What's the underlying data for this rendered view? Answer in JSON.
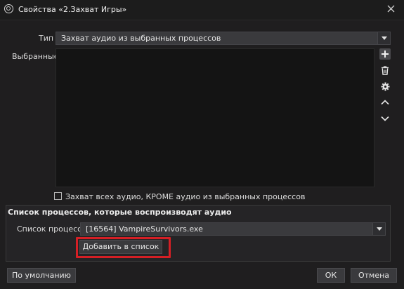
{
  "window": {
    "title": "Свойства «2.Захват Игры»"
  },
  "type_field": {
    "label": "Тип",
    "value": "Захват аудио из выбранных процессов"
  },
  "selected": {
    "label": "Выбранные"
  },
  "side_buttons": [
    "plus-icon",
    "trash-icon",
    "gear-icon",
    "chevron-up-icon",
    "chevron-down-icon"
  ],
  "capture_all_checkbox": {
    "label": "Захват всех аудио, КРОМЕ аудио из выбранных процессов",
    "checked": false
  },
  "process_group": {
    "title": "Список процессов, которые воспроизводят аудио",
    "process_label": "Список процессов",
    "process_value": "[16564] VampireSurvivors.exe",
    "add_button_label": "Добавить в список"
  },
  "footer": {
    "defaults_label": "По умолчанию",
    "ok_label": "ОК",
    "cancel_label": "Отмена"
  },
  "colors": {
    "background": "#1f1e1f",
    "highlight": "#d51f25",
    "field": "#3a3a3d"
  }
}
